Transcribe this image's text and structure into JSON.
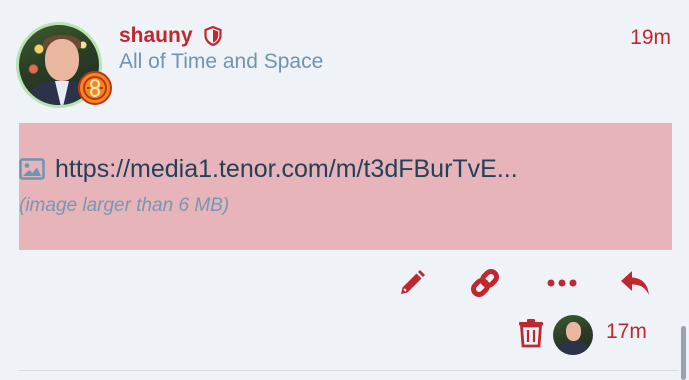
{
  "post": {
    "username": "shauny",
    "user_title": "All of Time and Space",
    "date": "19m",
    "avatar_icon": "user-avatar",
    "flair_icon": "seal-of-rassilon-flair-icon",
    "moderator_icon": "shield-icon"
  },
  "onebox": {
    "url": "https://media1.tenor.com/m/t3dFBurTvE...",
    "note": "(image larger than 6 MB)",
    "icon": "image-icon"
  },
  "actions": [
    {
      "name": "edit",
      "icon": "pencil-icon"
    },
    {
      "name": "copy-link",
      "icon": "link-icon"
    },
    {
      "name": "more",
      "icon": "ellipsis-icon"
    },
    {
      "name": "reply",
      "icon": "reply-icon"
    }
  ],
  "edit_info": {
    "date": "17m",
    "delete_icon": "trash-icon"
  },
  "colors": {
    "accent": "#c0282f",
    "background": "#eff3f8",
    "onebox_background": "#e6b4b9",
    "muted": "#6e94b4",
    "link_text": "#233f5a"
  }
}
